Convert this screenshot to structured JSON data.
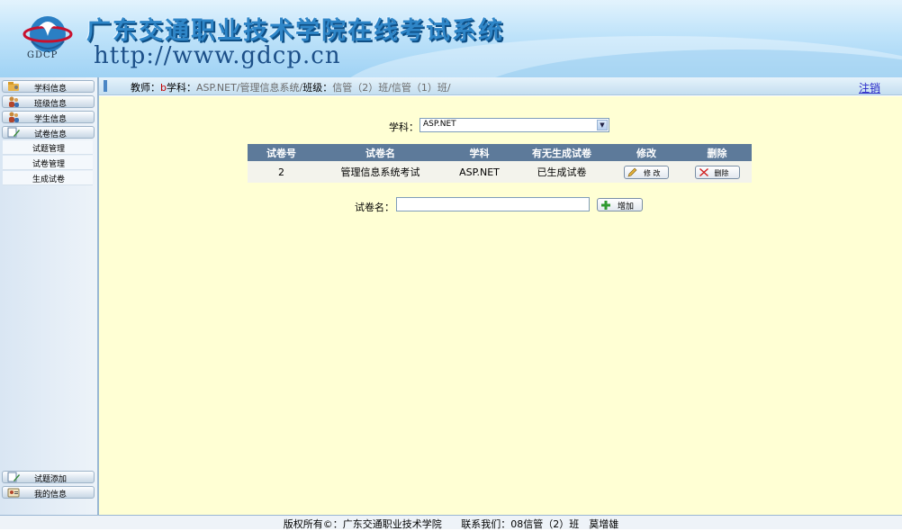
{
  "header": {
    "logo_text": "GDCP",
    "title": "广东交通职业技术学院在线考试系统",
    "url": "http://www.gdcp.cn"
  },
  "sidebar": {
    "items": [
      {
        "label": "学科信息",
        "icon": "folder-gear-icon"
      },
      {
        "label": "班级信息",
        "icon": "users-icon"
      },
      {
        "label": "学生信息",
        "icon": "users-icon"
      },
      {
        "label": "试卷信息",
        "icon": "document-pen-icon"
      }
    ],
    "subitems": [
      "试题管理",
      "试卷管理",
      "生成试卷"
    ],
    "bottom_items": [
      {
        "label": "试题添加",
        "icon": "document-pen-icon"
      },
      {
        "label": "我的信息",
        "icon": "user-card-icon"
      }
    ]
  },
  "infobar": {
    "teacher_label": "教师：",
    "teacher_value": "b",
    "subject_label": "学科：",
    "subject_value": "ASP.NET/管理信息系统/",
    "class_label": "班级：",
    "class_value": "信管（2）班/信管（1）班/",
    "logout": "注销"
  },
  "main": {
    "subject_label": "学科：",
    "subject_selected": "ASP.NET",
    "table": {
      "headers": [
        "试卷号",
        "试卷名",
        "学科",
        "有无生成试卷",
        "修改",
        "删除"
      ],
      "rows": [
        {
          "id": "2",
          "name": "管理信息系统考试",
          "subject": "ASP.NET",
          "generated": "已生成试卷",
          "edit": "修 改",
          "delete": "删除"
        }
      ]
    },
    "name_label": "试卷名：",
    "name_value": "",
    "add_button": "增加"
  },
  "footer": {
    "copyright": "版权所有©：广东交通职业技术学院",
    "contact": "联系我们：08信管（2）班　莫增雄"
  },
  "colors": {
    "table_header": "#5d7a9a",
    "main_bg": "#ffffd4",
    "title_blue": "#2f86c8"
  }
}
